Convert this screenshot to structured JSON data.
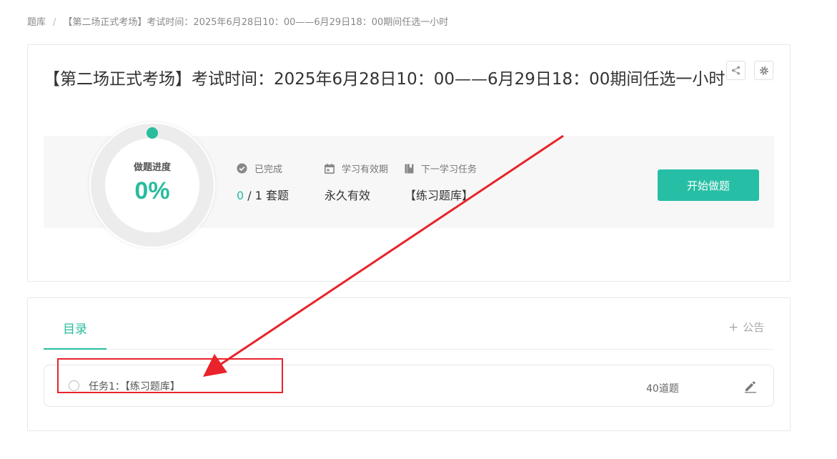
{
  "breadcrumb": {
    "root": "题库",
    "separator": "/",
    "current": "【第二场正式考场】考试时间：2025年6月28日10：00——6月29日18：00期间任选一小时"
  },
  "header": {
    "title": "【第二场正式考场】考试时间：2025年6月28日10：00——6月29日18：00期间任选一小时",
    "share_icon": "share-icon",
    "settings_icon": "gear-icon"
  },
  "progress": {
    "label": "做题进度",
    "value_text": "0%",
    "percent": 0
  },
  "stats": {
    "completed": {
      "label": "已完成",
      "done": "0",
      "rest": "/ 1 套题",
      "icon": "check-circle-icon"
    },
    "validity": {
      "label": "学习有效期",
      "value": "永久有效",
      "icon": "calendar-icon"
    },
    "next_task": {
      "label": "下一学习任务",
      "value": "【练习题库】",
      "icon": "book-icon"
    }
  },
  "start_button": "开始做题",
  "tabs": {
    "catalog": "目录",
    "notice_plus": "+",
    "notice": "公告"
  },
  "tasks": [
    {
      "name": "任务1：【练习题库】",
      "count": "40道题",
      "edit_icon": "pencil-icon"
    }
  ],
  "colors": {
    "accent": "#26bfa5",
    "annotation": "#e8232b",
    "panel_bg": "#f7f7f7"
  }
}
